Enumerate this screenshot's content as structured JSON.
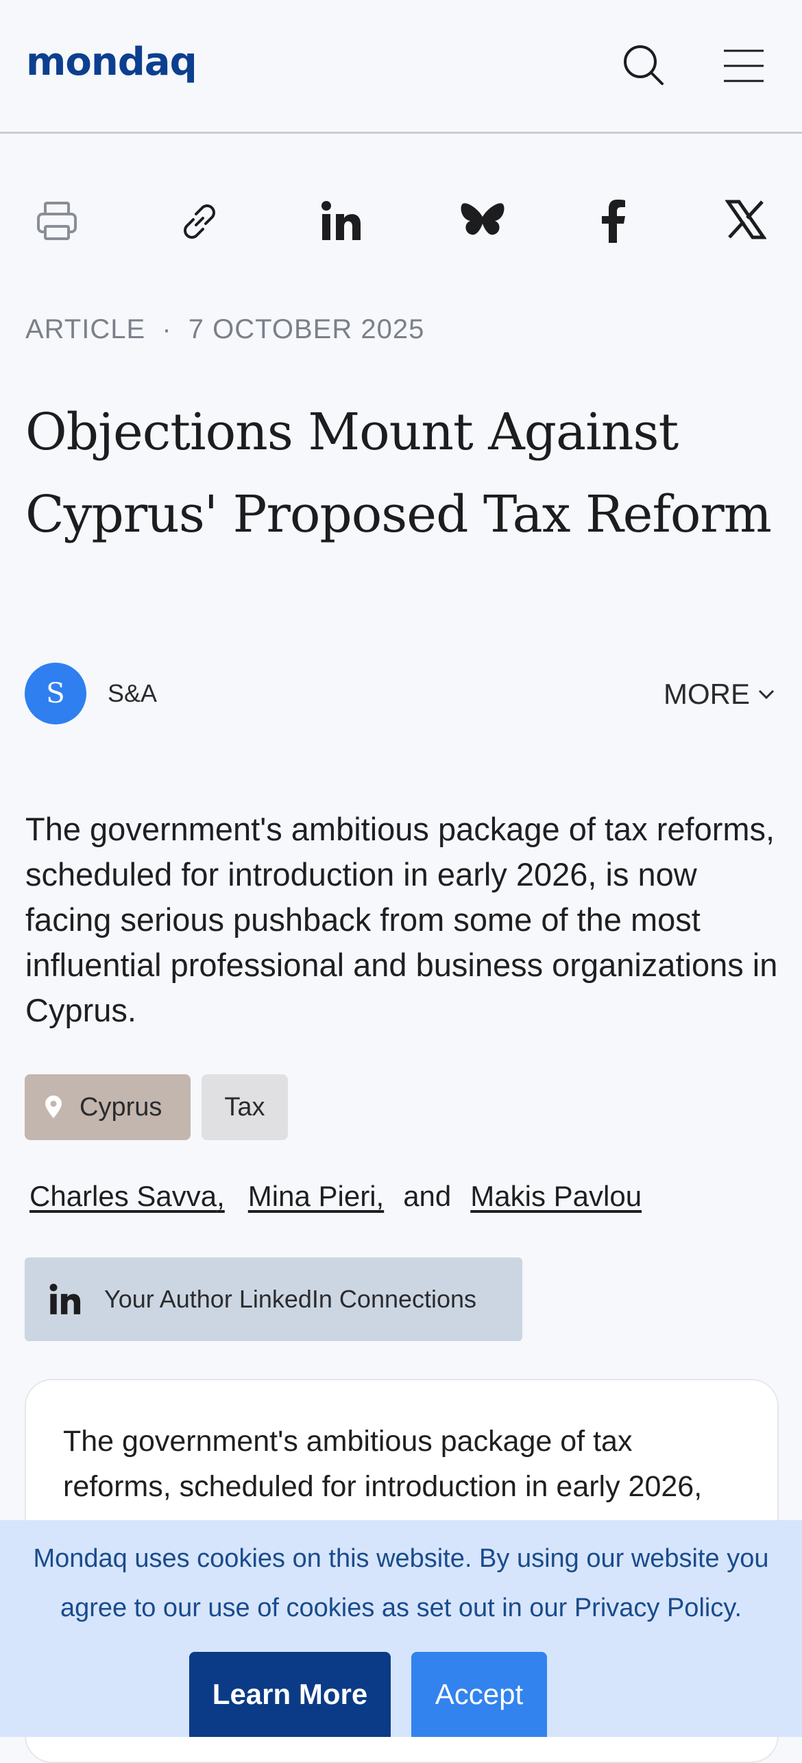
{
  "header": {
    "logo": "mondaq",
    "icons": [
      "search-icon",
      "menu-icon"
    ]
  },
  "share": {
    "icons": [
      "print-icon",
      "link-icon",
      "linkedin-icon",
      "bluesky-icon",
      "facebook-icon",
      "x-icon"
    ]
  },
  "article": {
    "type": "ARTICLE",
    "separator": "·",
    "date": "7 OCTOBER 2025",
    "title": "Objections Mount Against Cyprus' Proposed Tax Reform",
    "avatar_letter": "S",
    "firm": "S&A",
    "more_label": "MORE",
    "summary": "The government's ambitious package of tax reforms, scheduled for introduction in early 2026, is now facing serious pushback from some of the most influential professional and business organizations in Cyprus.",
    "tags": [
      "Cyprus",
      "Tax"
    ],
    "authors": {
      "a1": "Charles Savva",
      "a2": "Mina Pieri",
      "a3": "Makis Pavlou",
      "comma": ",",
      "and": "and"
    },
    "linkedin_label": "Your Author LinkedIn Connections",
    "body_preview": "The government's ambitious package of tax reforms, scheduled for introduction in early 2026,"
  },
  "cookie": {
    "text": "Mondaq uses cookies on this website. By using our website you agree to our use of cookies as set out in our Privacy Policy.",
    "learn_more": "Learn More",
    "accept": "Accept"
  },
  "colors": {
    "brand": "#0d3f8f",
    "avatar": "#2f7ff0",
    "cookie_bg": "#d6e5fb",
    "learn_more_bg": "#0b3b86",
    "accept_bg": "#3283ee"
  }
}
